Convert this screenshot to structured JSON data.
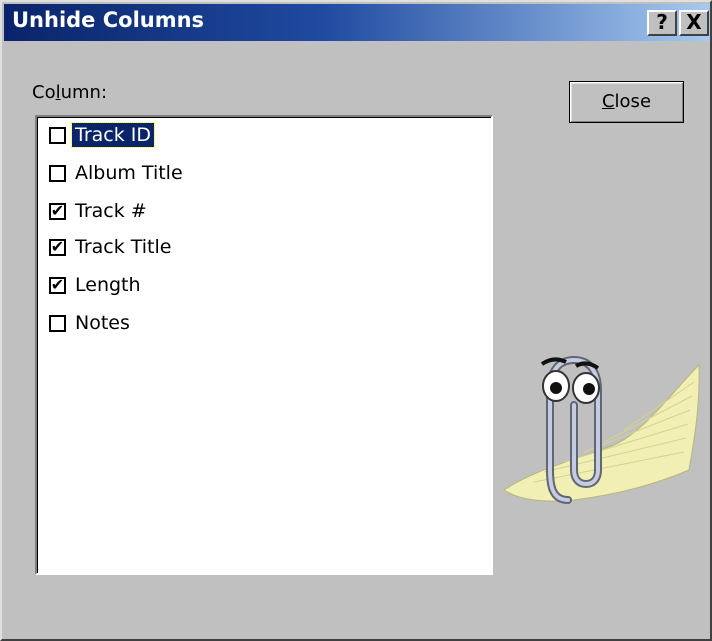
{
  "window": {
    "title": "Unhide Columns",
    "help_button": "?",
    "close_button": "X"
  },
  "column_list": {
    "label_before": "Co",
    "label_accel": "l",
    "label_after": "umn:",
    "items": [
      {
        "label": "Track ID",
        "checked": false,
        "selected": true
      },
      {
        "label": "Album Title",
        "checked": false,
        "selected": false
      },
      {
        "label": "Track #",
        "checked": true,
        "selected": false
      },
      {
        "label": "Track Title",
        "checked": true,
        "selected": false
      },
      {
        "label": "Length",
        "checked": true,
        "selected": false
      },
      {
        "label": "Notes",
        "checked": false,
        "selected": false
      }
    ]
  },
  "close_action": {
    "accel": "C",
    "rest": "lose"
  },
  "colors": {
    "title_start": "#0a246a",
    "title_end": "#a6caf0",
    "dialog_face": "#c0c0c0",
    "selection": "#0a246a"
  },
  "assistant": {
    "icon": "office-assistant-paperclip-icon"
  }
}
